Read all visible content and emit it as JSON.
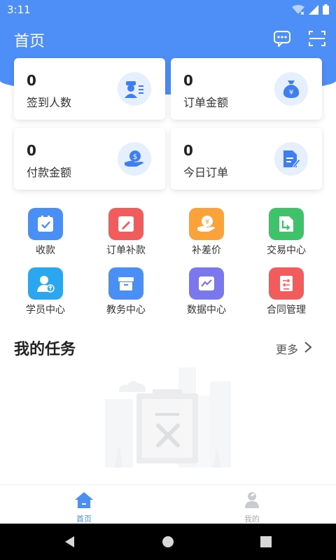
{
  "status": {
    "time": "3:11"
  },
  "header": {
    "title": "首页"
  },
  "stats": [
    {
      "value": "0",
      "label": "签到人数",
      "icon": "user-checkin-icon"
    },
    {
      "value": "0",
      "label": "订单金额",
      "icon": "money-bag-icon"
    },
    {
      "value": "0",
      "label": "付款金额",
      "icon": "payment-hand-icon"
    },
    {
      "value": "0",
      "label": "今日订单",
      "icon": "document-edit-icon"
    }
  ],
  "menu": [
    {
      "label": "收款",
      "color": "#4a8ff5"
    },
    {
      "label": "订单补款",
      "color": "#f35c5c"
    },
    {
      "label": "补差价",
      "color": "#fba23b"
    },
    {
      "label": "交易中心",
      "color": "#3ec36b"
    },
    {
      "label": "学员中心",
      "color": "#2ba6f0"
    },
    {
      "label": "教务中心",
      "color": "#4a8ff5"
    },
    {
      "label": "数据中心",
      "color": "#7b77ee"
    },
    {
      "label": "合同管理",
      "color": "#f35c5c"
    }
  ],
  "tasks": {
    "title": "我的任务",
    "more": "更多"
  },
  "tabbar": {
    "tabs": [
      {
        "label": "首页",
        "active": true
      },
      {
        "label": "我的",
        "active": false
      }
    ]
  },
  "theme": {
    "primary": "#4d8ef7"
  }
}
